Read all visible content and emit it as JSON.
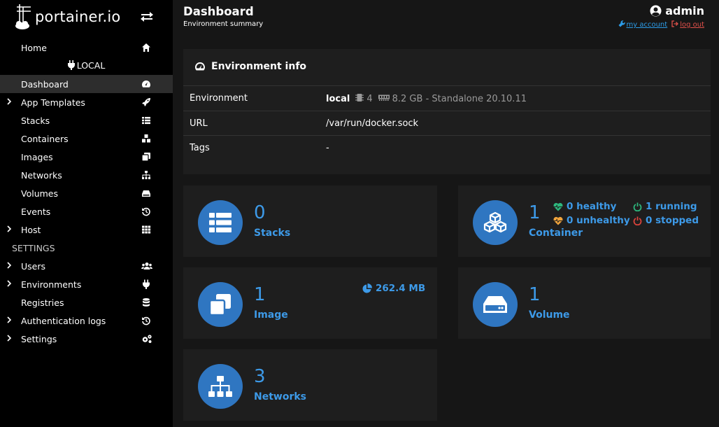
{
  "brand": {
    "name": "portainer.io"
  },
  "sidebar": {
    "home": "Home",
    "env_label": "LOCAL",
    "items": [
      {
        "label": "Dashboard"
      },
      {
        "label": "App Templates"
      },
      {
        "label": "Stacks"
      },
      {
        "label": "Containers"
      },
      {
        "label": "Images"
      },
      {
        "label": "Networks"
      },
      {
        "label": "Volumes"
      },
      {
        "label": "Events"
      },
      {
        "label": "Host"
      }
    ],
    "settings_header": "SETTINGS",
    "settings_items": [
      {
        "label": "Users"
      },
      {
        "label": "Environments"
      },
      {
        "label": "Registries"
      },
      {
        "label": "Authentication logs"
      },
      {
        "label": "Settings"
      }
    ]
  },
  "header": {
    "title": "Dashboard",
    "subtitle": "Environment summary",
    "username": "admin",
    "my_account": "my account",
    "log_out": "log out"
  },
  "env_info": {
    "title": "Environment info",
    "rows": [
      {
        "key": "Environment",
        "name": "local",
        "cpu": "4",
        "mem": "8.2 GB",
        "detail": "- Standalone 20.10.11"
      },
      {
        "key": "URL",
        "value": "/var/run/docker.sock"
      },
      {
        "key": "Tags",
        "value": "-"
      }
    ]
  },
  "cards": {
    "stacks": {
      "count": "0",
      "label": "Stacks"
    },
    "containers": {
      "count": "1",
      "label": "Container",
      "healthy": "0 healthy",
      "unhealthy": "0 unhealthy",
      "running": "1 running",
      "stopped": "0 stopped"
    },
    "images": {
      "count": "1",
      "label": "Image",
      "size": "262.4 MB"
    },
    "volumes": {
      "count": "1",
      "label": "Volume"
    },
    "networks": {
      "count": "3",
      "label": "Networks"
    }
  },
  "colors": {
    "accent": "#3d9ae8",
    "circle": "#2f76c1",
    "healthy": "#2db67c",
    "unhealthy": "#f0a43c",
    "running": "#2db67c",
    "stopped": "#d9433b",
    "logout": "#e0504a"
  }
}
